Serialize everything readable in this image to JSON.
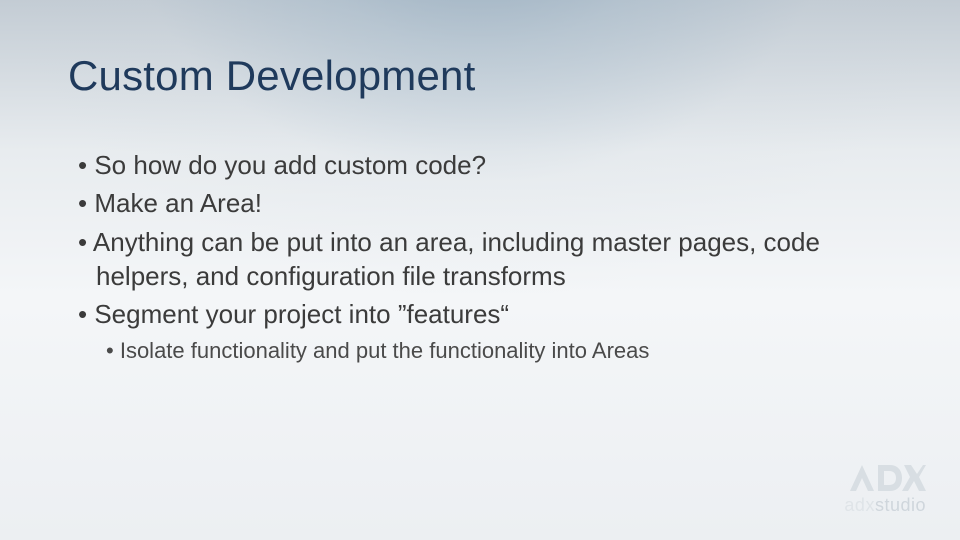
{
  "title": "Custom Development",
  "bullets": [
    {
      "level": 1,
      "text": "So how do you add custom code?"
    },
    {
      "level": 1,
      "text": "Make an Area!"
    },
    {
      "level": 1,
      "text": "Anything can be put into an area, including master pages, code helpers, and configuration file transforms"
    },
    {
      "level": 1,
      "text": "Segment your project into ”features“"
    },
    {
      "level": 2,
      "text": "Isolate functionality and put the functionality into Areas"
    }
  ],
  "brand": {
    "mark_label": "ADX",
    "word_prefix": "adx",
    "word_suffix": "studio"
  }
}
